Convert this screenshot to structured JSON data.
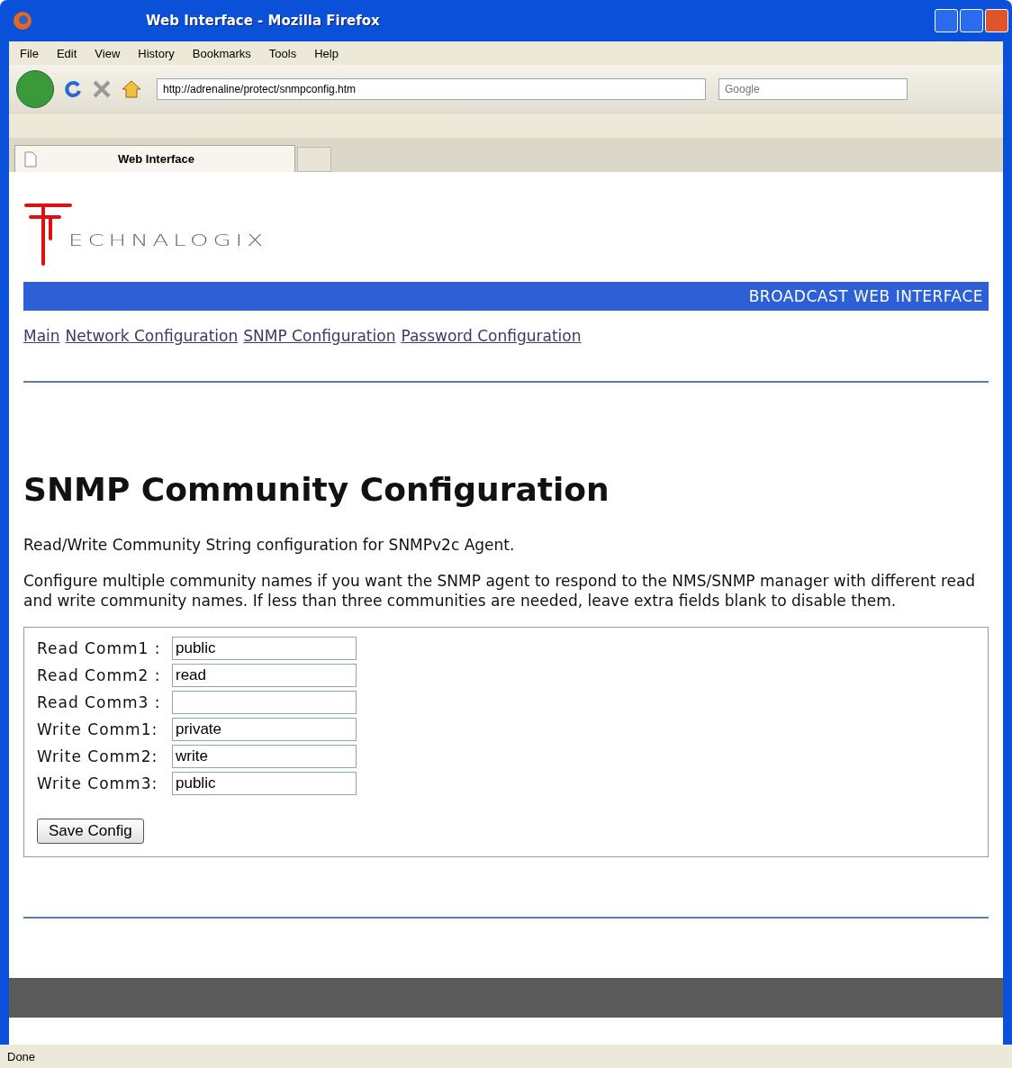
{
  "window": {
    "title": "Web Interface - Mozilla Firefox"
  },
  "menu": [
    "File",
    "Edit",
    "View",
    "History",
    "Bookmarks",
    "Tools",
    "Help"
  ],
  "address": {
    "value": "http://adrenaline/protect/snmpconfig.htm"
  },
  "search": {
    "placeholder": "Google"
  },
  "tabs": [
    {
      "label": "Web Interface",
      "selected": true
    }
  ],
  "page": {
    "logo": "ECHNALOGIX",
    "banner": "BROADCAST WEB INTERFACE",
    "nav": [
      "Main",
      "Network Configuration",
      "SNMP Configuration",
      "Password Configuration"
    ],
    "heading": "SNMP Community Configuration",
    "intro": "Read/Write Community String configuration for SNMPv2c Agent.",
    "description": "Configure multiple community names if you want the SNMP agent to respond to the NMS/SNMP manager with different read and write community names. If less than three communities are needed, leave extra fields blank to disable them.",
    "fields": [
      {
        "label": "Read Comm1 :",
        "value": "public"
      },
      {
        "label": "Read Comm2 :",
        "value": "read"
      },
      {
        "label": "Read Comm3 :"
      },
      {
        "label": "Write Comm1:",
        "value": "private"
      },
      {
        "label": "Write Comm2:",
        "value": "write"
      },
      {
        "label": "Write Comm3:",
        "value": "public"
      }
    ],
    "button": "Save Config"
  },
  "status_bar": "Done"
}
